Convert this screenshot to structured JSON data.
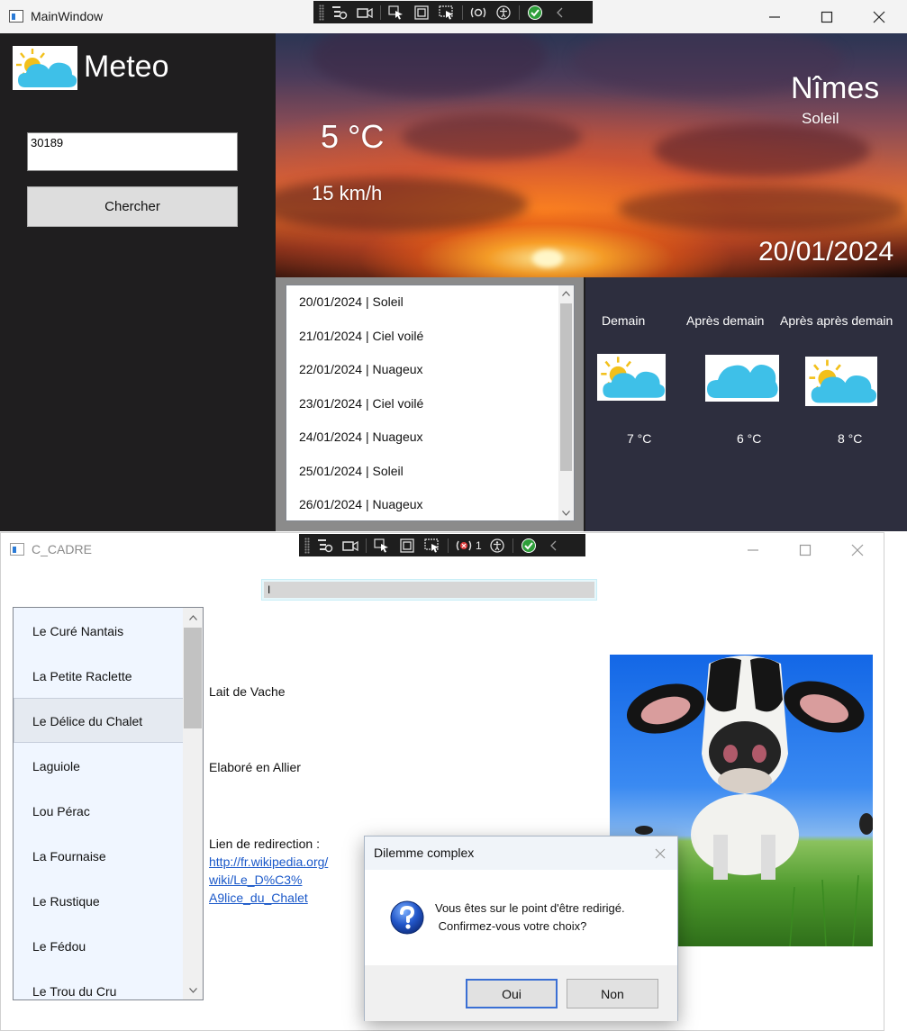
{
  "window_main": {
    "title": "MainWindow",
    "app_name": "Meteo",
    "search_value": "30189",
    "search_button_label": "Chercher",
    "current": {
      "temperature": "5 °C",
      "wind": "15 km/h",
      "city": "Nîmes",
      "condition": "Soleil",
      "date": "20/01/2024"
    },
    "forecast_list": [
      "20/01/2024 | Soleil",
      "21/01/2024 | Ciel voilé",
      "22/01/2024 | Nuageux",
      "23/01/2024 | Ciel voilé",
      "24/01/2024 | Nuageux",
      "25/01/2024 | Soleil",
      "26/01/2024 | Nuageux"
    ],
    "next_days": [
      {
        "label": "Demain",
        "icon": "sun-cloud-icon",
        "temperature": "7 °C"
      },
      {
        "label": "Après demain",
        "icon": "cloud-icon",
        "temperature": "6 °C"
      },
      {
        "label": "Après après demain",
        "icon": "sun-cloud-icon",
        "temperature": "8 °C"
      }
    ]
  },
  "window_cadre": {
    "title": "C_CADRE",
    "name_input_value": "I",
    "cheeses": [
      "Le Curé Nantais",
      "La Petite Raclette",
      "Le Délice du Chalet",
      "Laguiole",
      "Lou Pérac",
      "La Fournaise",
      "Le Rustique",
      "Le Fédou",
      "Le Trou du Cru"
    ],
    "selected_cheese": "Le Délice du Chalet",
    "milk": "Lait de Vache",
    "origin": "Elaboré en Allier",
    "link_label": "Lien de redirection :",
    "link_lines": [
      "http://fr.wikipedia.org/",
      "wiki/Le_D%C3%",
      "A9lice_du_Chalet"
    ]
  },
  "devtools_bar": {
    "error_count": "1"
  },
  "dialog": {
    "title": "Dilemme complex",
    "message_line1": "Vous êtes sur le point d'être redirigé.",
    "message_line2": " Confirmez-vous votre choix?",
    "yes_label": "Oui",
    "no_label": "Non"
  },
  "colors": {
    "dark_bg": "#1f1e1f",
    "forecast_panel": "#2d2e3e",
    "link": "#1a58c9",
    "dialog_accent": "#3a6fd4"
  }
}
